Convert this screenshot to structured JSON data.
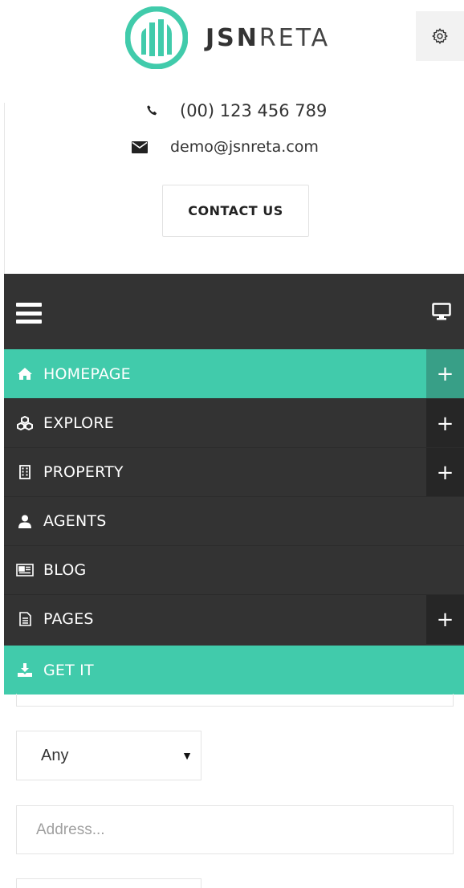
{
  "header": {
    "brand_bold": "JSN",
    "brand_light": "RETA",
    "settings_icon": "gear-icon"
  },
  "contact": {
    "phone": "(00) 123 456 789",
    "email": "demo@jsnreta.com",
    "button_label": "CONTACT US"
  },
  "menu": {
    "toggle_icon": "hamburger-icon",
    "view_icon": "monitor-icon",
    "items": [
      {
        "label": "HOMEPAGE",
        "icon": "home-icon",
        "active": true,
        "expandable": true
      },
      {
        "label": "EXPLORE",
        "icon": "cubes-icon",
        "active": false,
        "expandable": true
      },
      {
        "label": "PROPERTY",
        "icon": "building-icon",
        "active": false,
        "expandable": true
      },
      {
        "label": "AGENTS",
        "icon": "user-icon",
        "active": false,
        "expandable": false
      },
      {
        "label": "BLOG",
        "icon": "newspaper-icon",
        "active": false,
        "expandable": false
      },
      {
        "label": "PAGES",
        "icon": "file-icon",
        "active": false,
        "expandable": true
      },
      {
        "label": "GET IT",
        "icon": "download-icon",
        "active": true,
        "expandable": false
      }
    ],
    "expand_symbol": "+"
  },
  "search_form": {
    "type_select_value": "Any",
    "address_placeholder": "Address..."
  },
  "colors": {
    "accent": "#41cbab",
    "menu_bg": "#333333",
    "expander_bg": "#262626"
  }
}
